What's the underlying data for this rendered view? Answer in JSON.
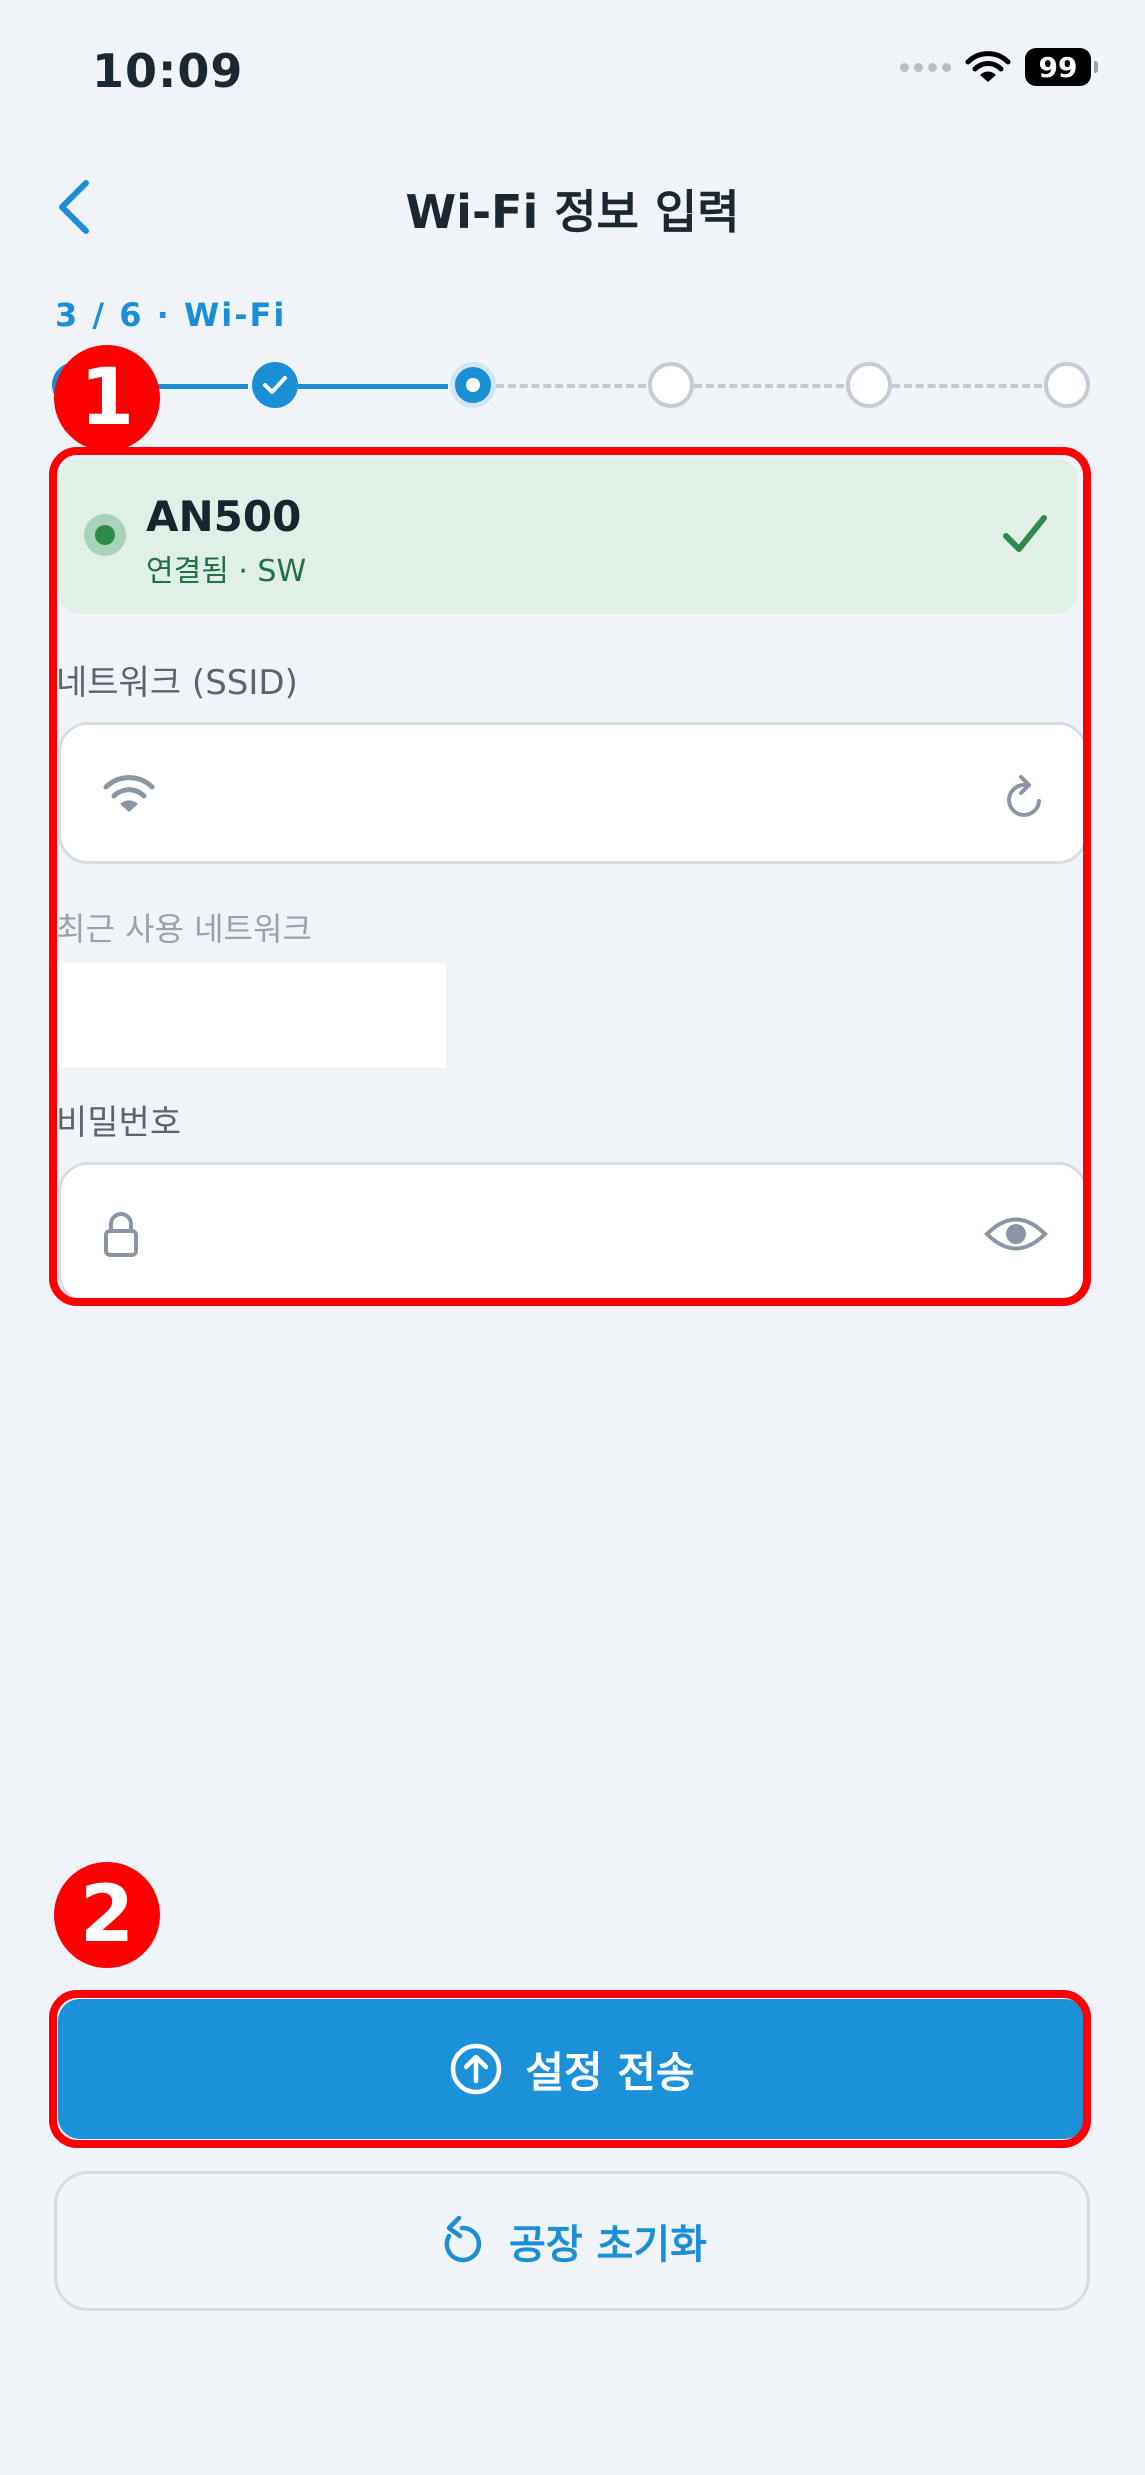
{
  "status_bar": {
    "time": "10:09",
    "battery": "99",
    "icons": [
      "signal-dots-icon",
      "wifi-icon",
      "battery-icon"
    ]
  },
  "nav": {
    "title": "Wi-Fi 정보 입력",
    "back_icon": "chevron-left-icon"
  },
  "stepper": {
    "label": "3 / 6  ·  Wi-Fi",
    "current": 3,
    "total": 6,
    "steps": [
      "done",
      "done",
      "current",
      "todo",
      "todo",
      "todo"
    ]
  },
  "annotations": {
    "badge1": "1",
    "badge2": "2",
    "color": "#ff0000"
  },
  "connected_device": {
    "name": "AN500",
    "status": "연결됨 · SW",
    "color": "#2f8a4e"
  },
  "ssid_field": {
    "label": "네트워크 (SSID)",
    "value": "",
    "lead_icon": "wifi-icon",
    "trail_icon": "refresh-icon"
  },
  "recent": {
    "label": "최근 사용 네트워크"
  },
  "password_field": {
    "label": "비밀번호",
    "value": "",
    "lead_icon": "lock-icon",
    "trail_icon": "eye-icon"
  },
  "actions": {
    "submit_label": "설정 전송",
    "submit_icon": "upload-circle-icon",
    "reset_label": "공장 초기화",
    "reset_icon": "reset-icon"
  },
  "colors": {
    "accent": "#1a91d8",
    "background": "#f0f3f8",
    "success": "#2f8a4e"
  }
}
